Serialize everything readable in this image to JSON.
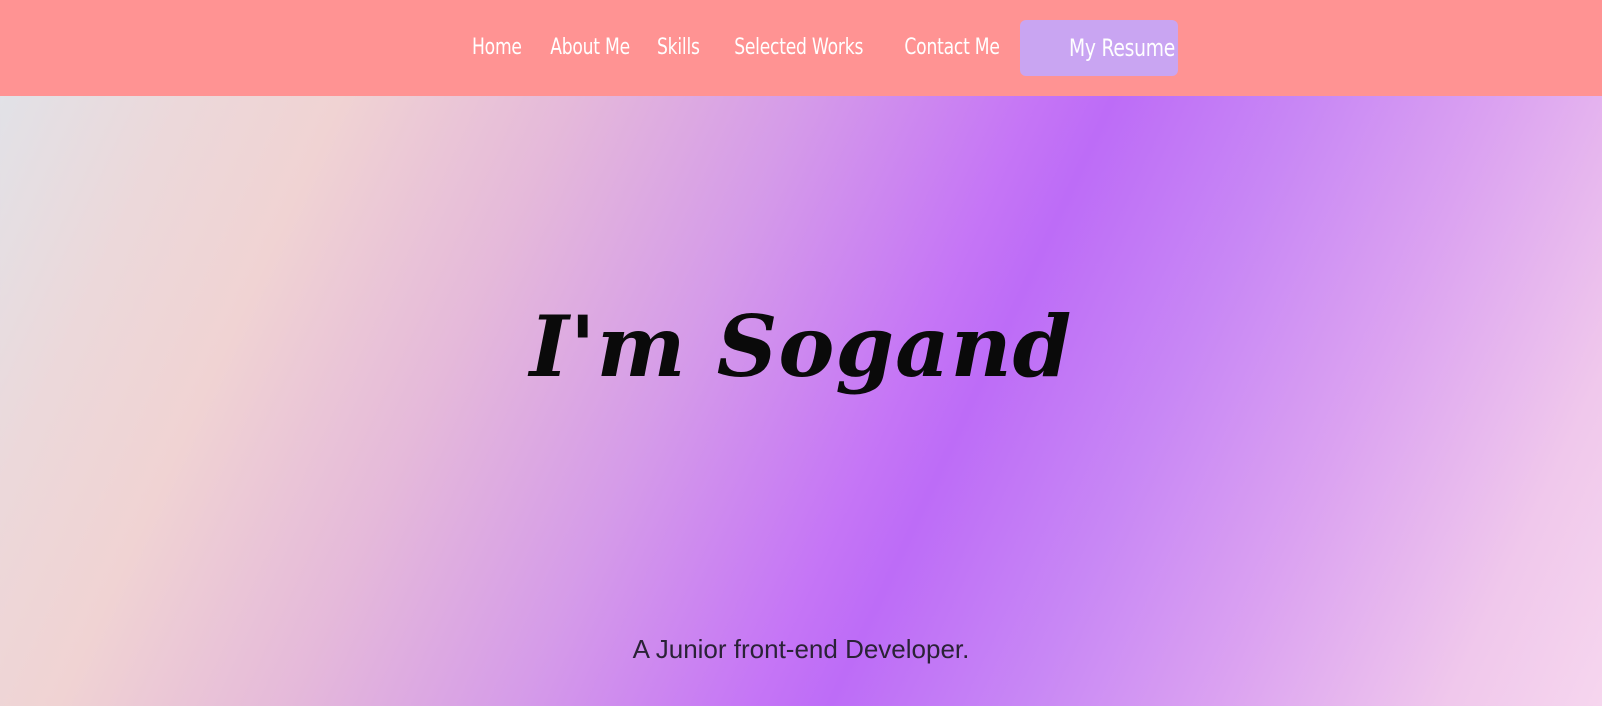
{
  "nav": {
    "items": [
      {
        "label": "Home"
      },
      {
        "label": "About Me"
      },
      {
        "label": "Skills"
      },
      {
        "label": "Selected Works"
      },
      {
        "label": "Contact Me"
      }
    ],
    "resume_label": "My Resume"
  },
  "hero": {
    "title": "I'm Sogand",
    "subtitle": "A Junior front-end Developer."
  },
  "colors": {
    "navbar": "#ff9393",
    "resume_button": "#c9a5f2",
    "gradient_purple": "#bd6cf7"
  }
}
